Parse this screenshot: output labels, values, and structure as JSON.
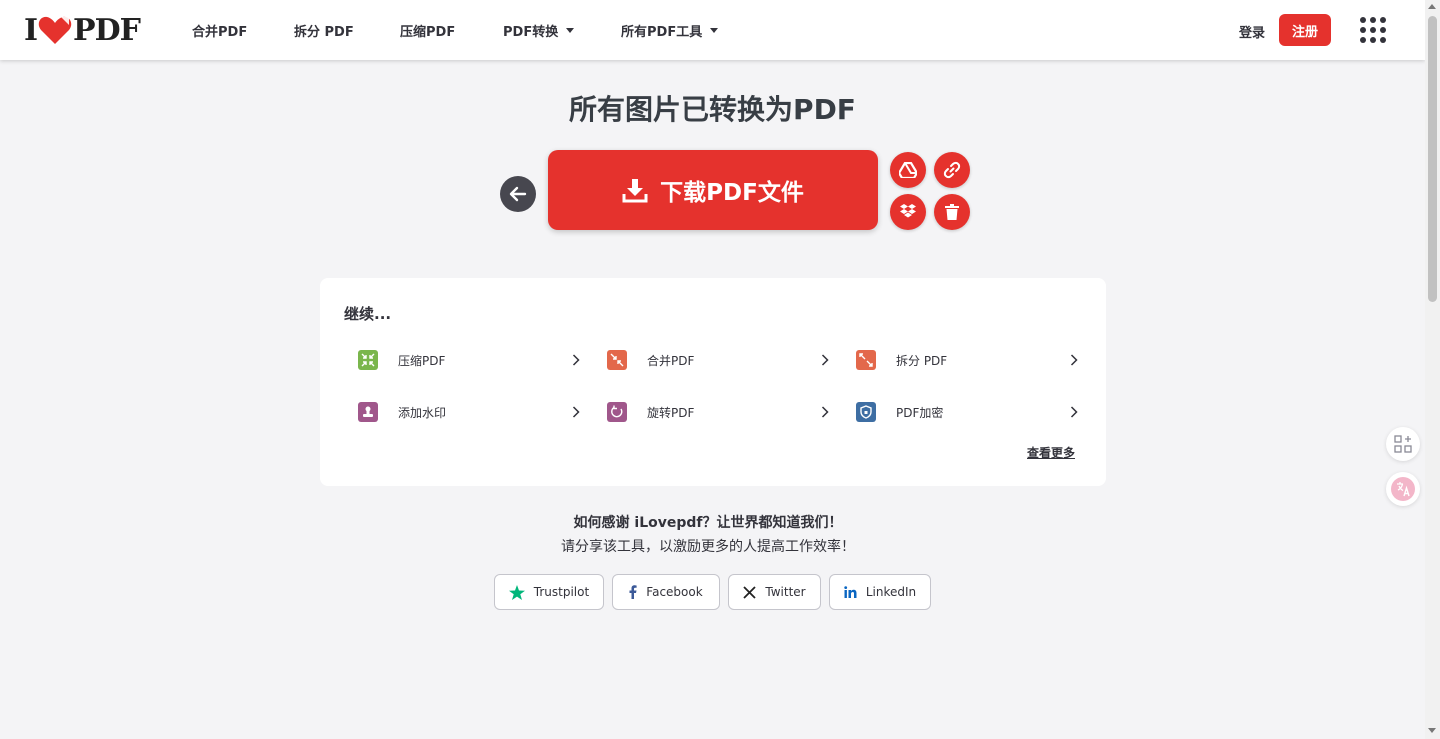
{
  "brand": {
    "logo_left": "I",
    "logo_right": "PDF",
    "accent_color": "#e5322d"
  },
  "nav": {
    "items": [
      {
        "label": "合并PDF",
        "dropdown": false
      },
      {
        "label": "拆分 PDF",
        "dropdown": false
      },
      {
        "label": "压缩PDF",
        "dropdown": false
      },
      {
        "label": "PDF转换",
        "dropdown": true
      },
      {
        "label": "所有PDF工具",
        "dropdown": true
      }
    ],
    "login_label": "登录",
    "register_label": "注册",
    "apps_icon": "grid-icon"
  },
  "main": {
    "title": "所有图片已转换为PDF",
    "download_label": "下载PDF文件",
    "download_icon": "download-icon",
    "back_icon": "arrow-left-icon",
    "side_actions": [
      "google-drive-icon",
      "link-icon",
      "dropbox-icon",
      "trash-icon"
    ]
  },
  "continue_card": {
    "title": "继续...",
    "tools": [
      {
        "label": "压缩PDF",
        "icon": "compress-icon",
        "color": "#7ab64c"
      },
      {
        "label": "合并PDF",
        "icon": "merge-icon",
        "color": "#e3684b"
      },
      {
        "label": "拆分 PDF",
        "icon": "split-icon",
        "color": "#e3684b"
      },
      {
        "label": "添加水印",
        "icon": "watermark-icon",
        "color": "#a0578b"
      },
      {
        "label": "旋转PDF",
        "icon": "rotate-icon",
        "color": "#a0578b"
      },
      {
        "label": "PDF加密",
        "icon": "shield-icon",
        "color": "#3e6ea3"
      }
    ],
    "see_more": "查看更多"
  },
  "thanks": {
    "title": "如何感谢 iLovepdf？让世界都知道我们！",
    "subtitle": "请分享该工具，以激励更多的人提高工作效率！",
    "share": [
      {
        "label": "Trustpilot",
        "icon": "star-icon",
        "color": "#00b67a"
      },
      {
        "label": "Facebook",
        "icon": "facebook-icon",
        "color": "#3b5998"
      },
      {
        "label": "Twitter",
        "icon": "x-icon",
        "color": "#222222"
      },
      {
        "label": "LinkedIn",
        "icon": "linkedin-icon",
        "color": "#0a66c2"
      }
    ]
  },
  "side_widgets": [
    "add-app-icon",
    "translate-icon"
  ]
}
